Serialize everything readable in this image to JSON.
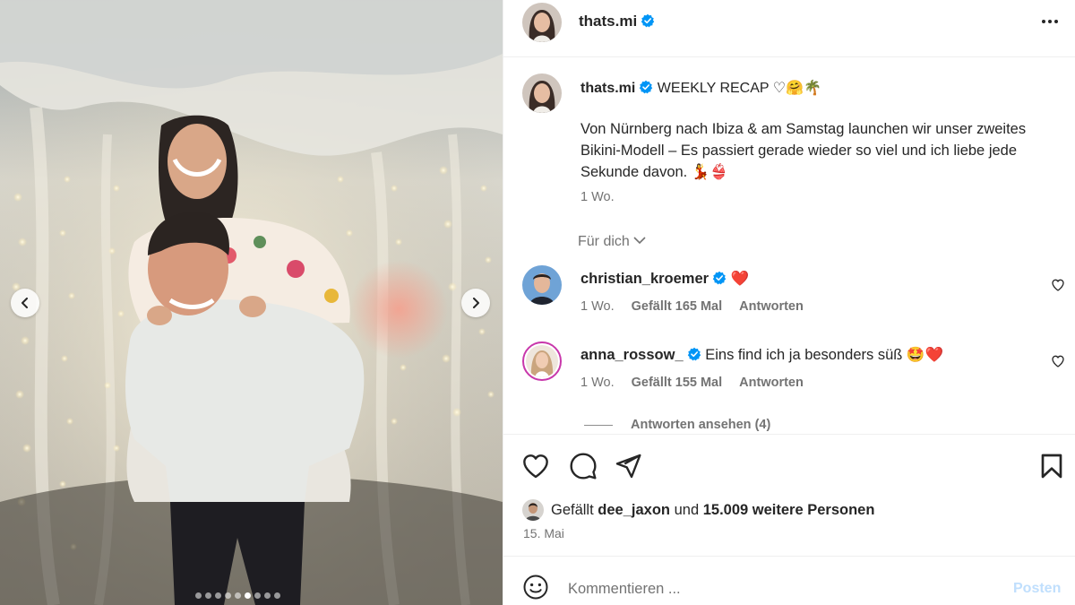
{
  "post": {
    "author": "thats.mi",
    "more_label": "Weitere Optionen"
  },
  "caption": {
    "author": "thats.mi",
    "headline": "WEEKLY RECAP ♡🤗🌴",
    "body": "Von Nürnberg nach Ibiza & am Samstag launchen wir unser zweites Bikini-Modell – Es passiert gerade wieder so viel und ich liebe jede Sekunde davon. 💃👙",
    "time": "1 Wo."
  },
  "filter": {
    "label": "Für dich"
  },
  "comments": [
    {
      "username": "christian_kroemer",
      "text": "❤️",
      "time": "1 Wo.",
      "likes": "Gefällt 165 Mal",
      "reply": "Antworten"
    },
    {
      "username": "anna_rossow_",
      "text": "Eins find ich ja besonders süß 🤩❤️",
      "time": "1 Wo.",
      "likes": "Gefällt 155 Mal",
      "reply": "Antworten"
    }
  ],
  "view_replies": "Antworten ansehen (4)",
  "likes": {
    "prefix": "Gefällt",
    "user": "dee_jaxon",
    "joiner": "und",
    "others": "15.009 weitere Personen"
  },
  "date": "15. Mai",
  "comment_bar": {
    "placeholder": "Kommentieren ...",
    "post_label": "Posten"
  },
  "carousel": {
    "total": 9,
    "active_index": 5
  },
  "icons": {
    "header": [
      "verified-badge-icon",
      "more-horizontal-icon"
    ],
    "actions": [
      "heart-icon",
      "comment-icon",
      "share-icon",
      "bookmark-icon"
    ],
    "carousel": [
      "chevron-left-icon",
      "chevron-right-icon"
    ],
    "comment_bar": [
      "emoji-icon"
    ]
  },
  "colors": {
    "verified": "#0095f6",
    "post_button_disabled": "#c0dffd",
    "secondary_text": "#737373",
    "divider": "#efefef"
  }
}
